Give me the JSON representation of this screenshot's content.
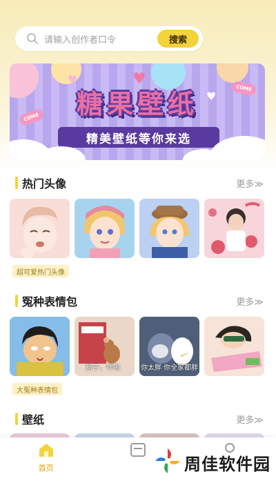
{
  "search": {
    "placeholder": "请输入创作者口令",
    "button_label": "搜索"
  },
  "banner": {
    "title": "糖果壁纸",
    "subtitle": "精美壁纸等你来选",
    "tag_left": "COME",
    "tag_right": "COME"
  },
  "sections": [
    {
      "title": "热门头像",
      "more": "更多≫",
      "caption": "超可爱热门头像"
    },
    {
      "title": "冤种表情包",
      "more": "更多≫",
      "caption": "大冤种表情包",
      "meme_texts": [
        "狗子，咋啦",
        "你太胖 你全家都胖"
      ]
    },
    {
      "title": "壁纸",
      "more": "更多≫"
    }
  ],
  "tabbar": {
    "items": [
      {
        "label": "首页",
        "active": true
      },
      {
        "label": "",
        "active": false
      },
      {
        "label": "",
        "active": false
      }
    ]
  },
  "watermark": {
    "text": "周佳软件园"
  },
  "colors": {
    "accent": "#f2d33b",
    "banner_purple": "#5a3a9e",
    "banner_pink": "#e970a6"
  }
}
